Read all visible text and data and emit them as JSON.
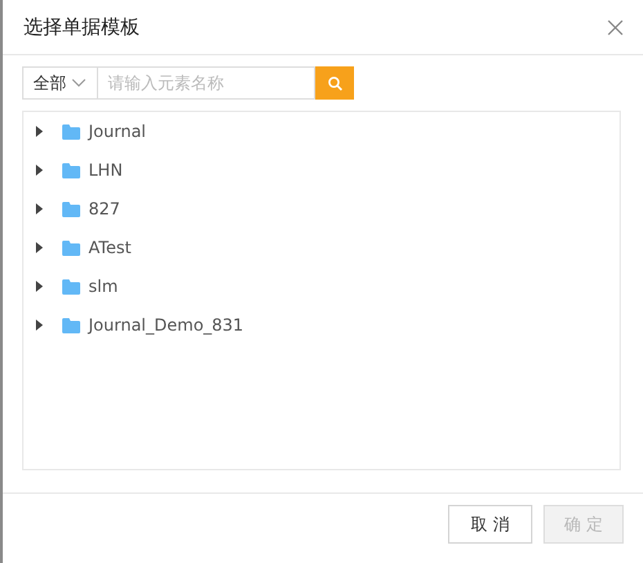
{
  "dialog": {
    "title": "选择单据模板"
  },
  "filter": {
    "scope": "全部",
    "search": {
      "placeholder": "请输入元素名称"
    }
  },
  "tree": [
    {
      "label": "Journal",
      "expanded": false
    },
    {
      "label": "LHN",
      "expanded": false
    },
    {
      "label": "827",
      "expanded": false
    },
    {
      "label": "ATest",
      "expanded": false
    },
    {
      "label": "slm",
      "expanded": false
    },
    {
      "label": "Journal_Demo_831",
      "expanded": false
    }
  ],
  "buttons": [
    {
      "label": "取消",
      "disabled": false
    },
    {
      "label": "确定",
      "disabled": true
    }
  ]
}
